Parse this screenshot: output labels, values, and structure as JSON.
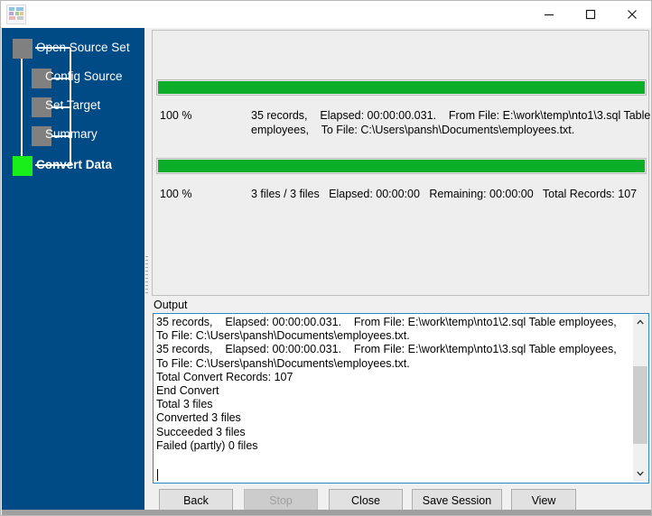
{
  "window": {
    "title": "",
    "icon": "database-table-icon",
    "controls": {
      "minimize": "minimize-icon",
      "maximize": "maximize-icon",
      "close": "close-icon"
    }
  },
  "colors": {
    "sidebar_blue": "#004a85",
    "progress_green": "#0cad28",
    "current_step_green": "#1aee1a",
    "step_gray": "#808080",
    "focus_border": "#2b86c5"
  },
  "sidebar": {
    "steps": [
      {
        "label": "Open Source Set",
        "state": "done",
        "active": false
      },
      {
        "label": "Config Source",
        "state": "done",
        "active": false
      },
      {
        "label": "Set Target",
        "state": "done",
        "active": false
      },
      {
        "label": "Summary",
        "state": "done",
        "active": false
      },
      {
        "label": "Convert Data",
        "state": "current",
        "active": true
      }
    ]
  },
  "progress": {
    "file_task": {
      "percent_label": "100 %",
      "percent_value": 100,
      "line1": "35 records,    Elapsed: 00:00:00.031.    From File: E:\\work\\temp\\nto1\\3.sql Table",
      "line2": "employees,    To File: C:\\Users\\pansh\\Documents\\employees.txt."
    },
    "overall_task": {
      "percent_label": "100 %",
      "percent_value": 100,
      "line1": "3 files / 3 files   Elapsed: 00:00:00   Remaining: 00:00:00   Total Records: 107"
    }
  },
  "output": {
    "label": "Output",
    "text": "35 records,    Elapsed: 00:00:00.031.    From File: E:\\work\\temp\\nto1\\2.sql Table employees,    To File: C:\\Users\\pansh\\Documents\\employees.txt.\n35 records,    Elapsed: 00:00:00.031.    From File: E:\\work\\temp\\nto1\\3.sql Table employees,    To File: C:\\Users\\pansh\\Documents\\employees.txt.\nTotal Convert Records: 107\nEnd Convert\nTotal 3 files\nConverted 3 files\nSucceeded 3 files\nFailed (partly) 0 files\n",
    "scrollbar": {
      "up_icon": "chevron-up-icon",
      "down_icon": "chevron-down-icon"
    }
  },
  "buttons": {
    "back": "Back",
    "stop": "Stop",
    "close": "Close",
    "save_session": "Save Session",
    "view": "View"
  }
}
